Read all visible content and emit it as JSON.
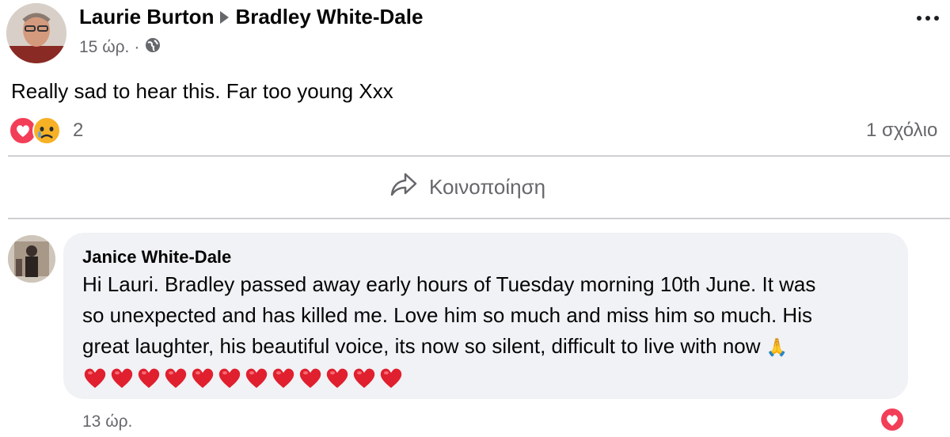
{
  "post": {
    "author": "Laurie Burton",
    "target": "Bradley White-Dale",
    "time": "15 ώρ.",
    "separator": "·",
    "audience_icon": "globe-icon",
    "text": "Really sad to hear this. Far too young Xxx",
    "reaction_icons": [
      "heart-reaction-icon",
      "sad-reaction-icon"
    ],
    "reaction_count": "2",
    "comments_count": "1 σχόλιο",
    "more_icon": "more-options-icon"
  },
  "actions": {
    "share_label": "Κοινοποίηση",
    "share_icon": "share-arrow-icon"
  },
  "comment": {
    "author": "Janice White-Dale",
    "text_lines": [
      "Hi Lauri. Bradley passed away early hours of Tuesday morning 10th June. It was",
      "so unexpected and has killed me. Love him so much and miss him so much. His",
      "great laughter, his beautiful voice, its now so silent, difficult to live with now"
    ],
    "pray_emoji": "🙏",
    "heart_count": 12,
    "time": "13 ώρ.",
    "reaction_icon": "heart-reaction-icon"
  },
  "colors": {
    "text": "#050505",
    "secondary": "#65676b",
    "bubble": "#f0f2f5",
    "love": "#f33e58",
    "heart_emoji": "#e0202e"
  }
}
